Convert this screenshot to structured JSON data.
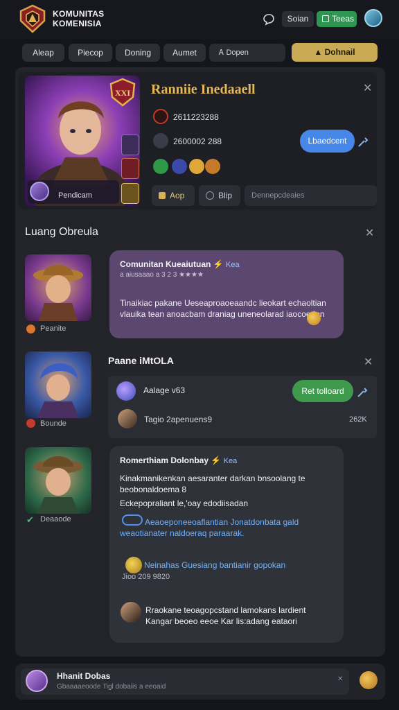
{
  "header": {
    "brand_line1": "KOMUNITAS",
    "brand_line2": "KOMENISIA",
    "btn_secondary": "Soian",
    "btn_primary": "Teeas"
  },
  "nav": {
    "tabs": [
      "Aleap",
      "Piecop",
      "Doning",
      "Aumet"
    ],
    "search_label": "Ꭺ Dopen",
    "cta": "▲ Dohnail"
  },
  "profile": {
    "title": "Ranniie Inedaaell",
    "caption": "Pendicam",
    "stat1": "2611223288",
    "stat2": "2600002 288",
    "action_button": "Lbaedcent",
    "tool_buttons": [
      "Aop",
      "Blip"
    ],
    "tool_placeholder": "Dennepcdeaies"
  },
  "chat": {
    "title": "Luang Obreula",
    "messages": [
      {
        "user": "Peanite",
        "name": "Comunitan Kueaiutuan",
        "tag": "Kea",
        "subline": "a aiusaaao a 3 2 3 ★★★★",
        "body": "Tinaikiac pakane Ueseaproaoeaandc lieokart echaoltian vlauika tean anoacbam draniag uneneolarad iaocoedon"
      },
      {
        "user": "Bounde",
        "panel_title": "Paane iMtOLA",
        "line1": "Aalage v63",
        "line2": "Tagio 2apenuens9",
        "count": "262K",
        "button": "Ret tolloard"
      },
      {
        "user": "Deaaode",
        "name": "Romerthiam Dolonbay",
        "tag": "Kea",
        "body1": "Kinakmanikenkan aesaranter darkan bnsoolang te beobonaldoema 8",
        "body2": "Eckepopraliant le,'oay edodiisadan",
        "link_text": "Aeaoeponeeoaflantian Jonatdonbata gald weaotianater naldoeraq paraarak.",
        "coin_text": "Neinahas Guesiang bantianir gopokan",
        "coin_sub": "Jioo  209 9820",
        "footer_text": "Rraokane teoagopcstand lamokans lardient Kangar beoeo eeoe Kar lis:adang eataori"
      }
    ]
  },
  "composer": {
    "name": "Hhanit Dobas",
    "placeholder": "Gbaaaaeoode Tigl dobaiis a eeoaid"
  },
  "colors": {
    "accent_gold": "#c9ab55",
    "accent_blue": "#4687e8",
    "accent_green": "#3f9a4e",
    "bubble_purple": "#5b4770",
    "bubble_dark": "#2f3239"
  }
}
